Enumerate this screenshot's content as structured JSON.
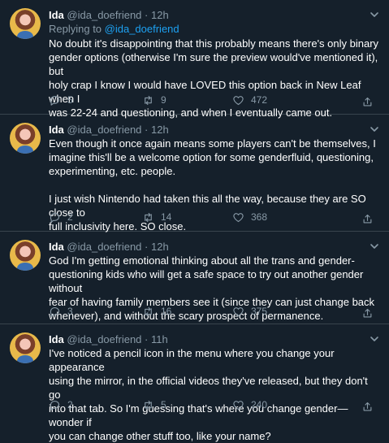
{
  "tweets": [
    {
      "name": "Ida",
      "handle": "@ida_doefriend",
      "separator": "·",
      "time": "12h",
      "replying_prefix": "Replying to ",
      "replying_handle": "@ida_doefriend",
      "text": "No doubt it's disappointing that this probably means there's only binary\ngender options (otherwise I'm sure the preview would've mentioned it), but\nholy crap I know I would have LOVED this option back in New Leaf when I\nwas 22-24 and questioning, and when I eventually came out.",
      "replies": "5",
      "retweets": "9",
      "likes": "472"
    },
    {
      "name": "Ida",
      "handle": "@ida_doefriend",
      "separator": "·",
      "time": "12h",
      "text": "Even though it once again means some players can't be themselves, I\nimagine this'll be a welcome option for some genderfluid, questioning,\nexperimenting, etc. people.\n\nI just wish Nintendo had taken this all the way, because they are SO close to\nfull inclusivity here. SO close.",
      "replies": "2",
      "retweets": "14",
      "likes": "368"
    },
    {
      "name": "Ida",
      "handle": "@ida_doefriend",
      "separator": "·",
      "time": "12h",
      "text": "God I'm getting emotional thinking about all the trans and gender-\nquestioning kids who will get a safe space to try out another gender without\nfear of having family members see it (since they can just change back\nwhenever), and without the scary prospect of permanence.",
      "replies": "3",
      "retweets": "16",
      "likes": "375"
    },
    {
      "name": "Ida",
      "handle": "@ida_doefriend",
      "separator": "·",
      "time": "11h",
      "text": "I've noticed a pencil icon in the menu where you change your appearance\nusing the mirror, in the official videos they've released, but they don't go\ninto that tab. So I'm guessing that's where you change gender—wonder if\nyou can change other stuff too, like your name?",
      "replies": "2",
      "retweets": "5",
      "likes": "240"
    }
  ],
  "icons": {
    "reply": "reply-icon",
    "retweet": "retweet-icon",
    "like": "like-icon",
    "share": "share-icon",
    "menu": "chevron-down-icon"
  },
  "colors": {
    "background": "#15202b",
    "muted": "#8899a6",
    "link": "#1da1f2",
    "divider": "#38444d"
  }
}
